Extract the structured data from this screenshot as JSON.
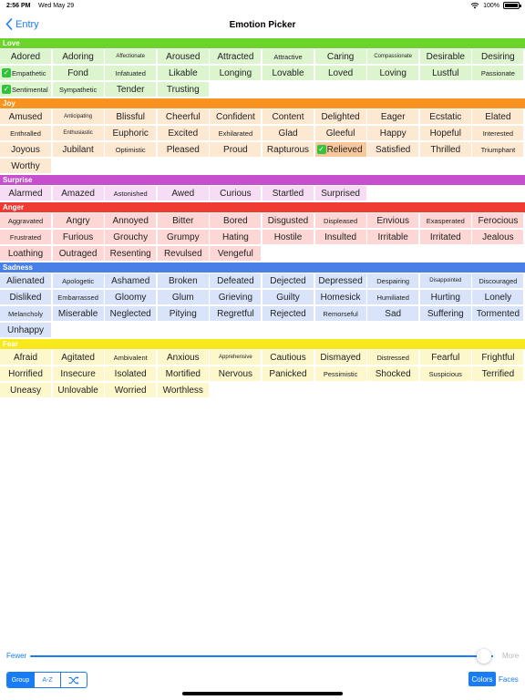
{
  "status_bar": {
    "time": "2:56 PM",
    "date": "Wed May 29",
    "battery": "100%"
  },
  "nav": {
    "back_label": "Entry",
    "title": "Emotion Picker"
  },
  "groups": [
    {
      "name": "Love",
      "header_color": "#6bd42a",
      "cell_color": "#ddf5cf",
      "words": [
        "Adored",
        "Adoring",
        "Affectionate",
        "Aroused",
        "Attracted",
        "Attractive",
        "Caring",
        "Compassionate",
        "Desirable",
        "Desiring",
        "Empathetic",
        "Fond",
        "Infatuated",
        "Likable",
        "Longing",
        "Lovable",
        "Loved",
        "Loving",
        "Lustful",
        "Passionate",
        "Sentimental",
        "Sympathetic",
        "Tender",
        "Trusting"
      ],
      "selected": [
        "Empathetic",
        "Sentimental"
      ]
    },
    {
      "name": "Joy",
      "header_color": "#f7931e",
      "cell_color": "#fde8d2",
      "words": [
        "Amused",
        "Anticipating",
        "Blissful",
        "Cheerful",
        "Confident",
        "Content",
        "Delighted",
        "Eager",
        "Ecstatic",
        "Elated",
        "Enthralled",
        "Enthusiastic",
        "Euphoric",
        "Excited",
        "Exhilarated",
        "Glad",
        "Gleeful",
        "Happy",
        "Hopeful",
        "Interested",
        "Joyous",
        "Jubilant",
        "Optimistic",
        "Pleased",
        "Proud",
        "Rapturous",
        "Relieved",
        "Satisfied",
        "Thrilled",
        "Triumphant",
        "Worthy"
      ],
      "selected": [
        "Relieved"
      ]
    },
    {
      "name": "Surprise",
      "header_color": "#c64fce",
      "cell_color": "#f6dcf4",
      "words": [
        "Alarmed",
        "Amazed",
        "Astonished",
        "Awed",
        "Curious",
        "Startled",
        "Surprised"
      ],
      "selected": []
    },
    {
      "name": "Anger",
      "header_color": "#ef3b32",
      "cell_color": "#fcd7d5",
      "words": [
        "Aggravated",
        "Angry",
        "Annoyed",
        "Bitter",
        "Bored",
        "Disgusted",
        "Displeased",
        "Envious",
        "Exasperated",
        "Ferocious",
        "Frustrated",
        "Furious",
        "Grouchy",
        "Grumpy",
        "Hating",
        "Hostile",
        "Insulted",
        "Irritable",
        "Irritated",
        "Jealous",
        "Loathing",
        "Outraged",
        "Resenting",
        "Revulsed",
        "Vengeful"
      ],
      "selected": []
    },
    {
      "name": "Sadness",
      "header_color": "#4a7fe8",
      "cell_color": "#d9e4fb",
      "words": [
        "Alienated",
        "Apologetic",
        "Ashamed",
        "Broken",
        "Defeated",
        "Dejected",
        "Depressed",
        "Despairing",
        "Disappointed",
        "Discouraged",
        "Disliked",
        "Embarrassed",
        "Gloomy",
        "Glum",
        "Grieving",
        "Guilty",
        "Homesick",
        "Humiliated",
        "Hurting",
        "Lonely",
        "Melancholy",
        "Miserable",
        "Neglected",
        "Pitying",
        "Regretful",
        "Rejected",
        "Remorseful",
        "Sad",
        "Suffering",
        "Tormented",
        "Unhappy"
      ],
      "selected": []
    },
    {
      "name": "Fear",
      "header_color": "#f8e81c",
      "cell_color": "#fdf7cc",
      "words": [
        "Afraid",
        "Agitated",
        "Ambivalent",
        "Anxious",
        "Apprehensive",
        "Cautious",
        "Dismayed",
        "Distressed",
        "Fearful",
        "Frightful",
        "Horrified",
        "Insecure",
        "Isolated",
        "Mortified",
        "Nervous",
        "Panicked",
        "Pessimistic",
        "Shocked",
        "Suspicious",
        "Terrified",
        "Uneasy",
        "Unlovable",
        "Worried",
        "Worthless"
      ],
      "selected": []
    }
  ],
  "selected_check_color": "#33c23e",
  "selected_cell_color_joy": "#f9c89a",
  "slider": {
    "min_label": "Fewer",
    "max_label": "More",
    "value_fraction": 0.98
  },
  "sort_segment": {
    "options": [
      "Group",
      "A-Z",
      "shuffle-icon"
    ],
    "active": "Group"
  },
  "view_buttons": {
    "colors_label": "Colors",
    "faces_label": "Faces",
    "active": "Colors"
  }
}
